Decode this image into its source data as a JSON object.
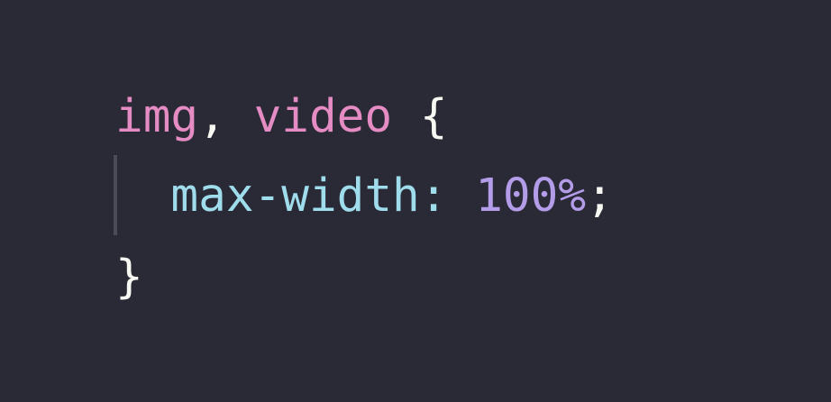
{
  "code": {
    "line1": {
      "selector_img": "img",
      "comma": ",",
      "selector_video": "video",
      "open_brace": "{"
    },
    "line2": {
      "property": "max-width",
      "colon": ":",
      "value": "100%",
      "semicolon": ";"
    },
    "line3": {
      "close_brace": "}"
    }
  },
  "colors": {
    "background": "#2a2a36",
    "selector": "#e58cc4",
    "property": "#9fdcec",
    "number": "#b39ce8",
    "punctuation": "#f8f8f2",
    "indent_guide": "#4a4a58"
  }
}
